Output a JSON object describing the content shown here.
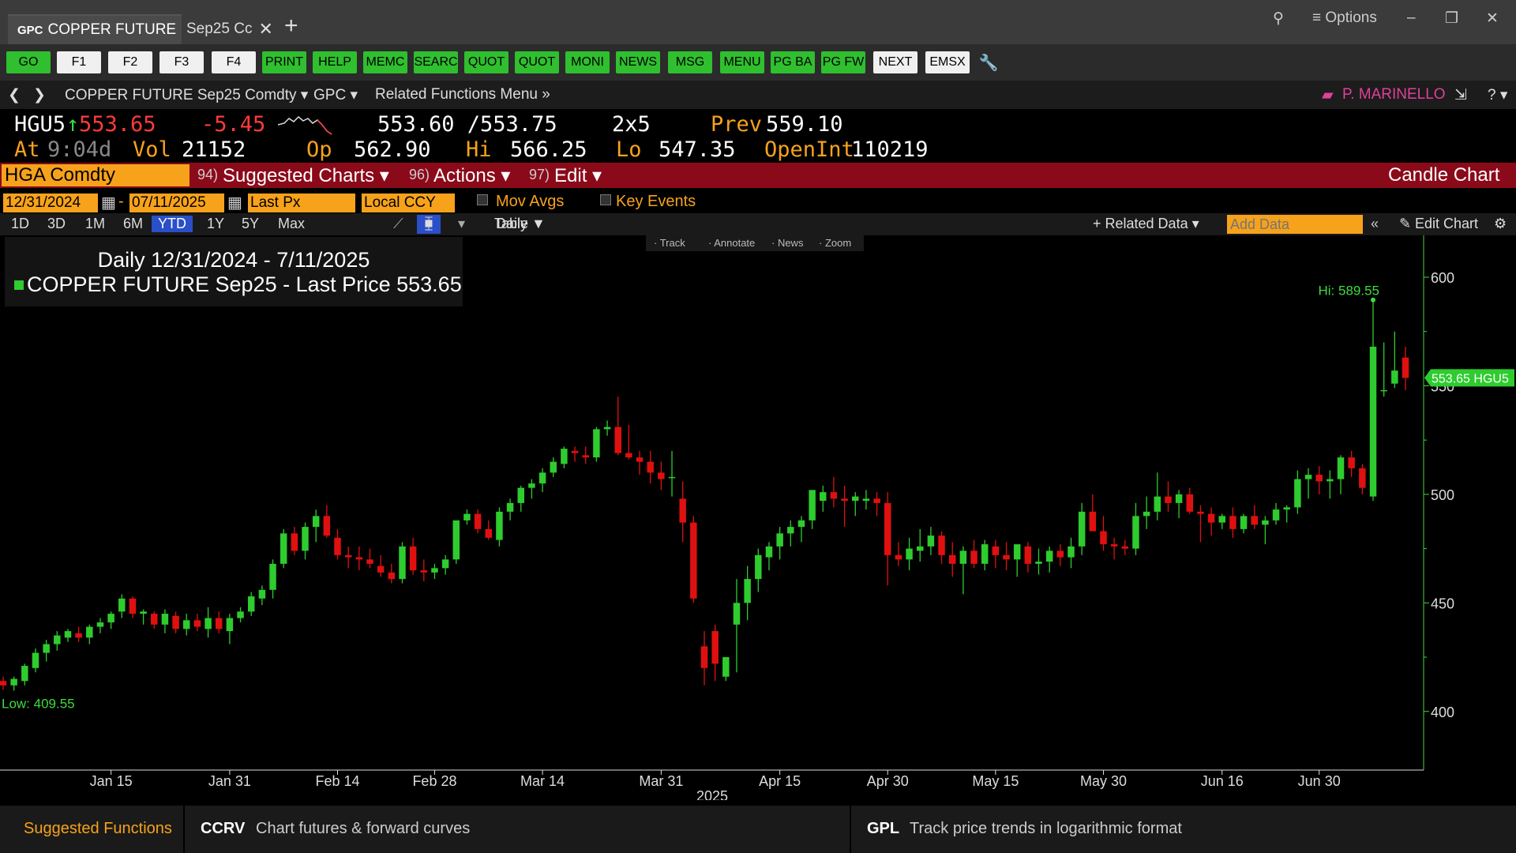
{
  "titlebar": {
    "tab1_prefix": "GPC",
    "tab1_label": "COPPER FUTURE",
    "tab2_label": "Sep25 Cc",
    "close_glyph": "✕",
    "new_tab_glyph": "+",
    "options_label": "≡ Options"
  },
  "buttons": [
    {
      "label": "GO",
      "style": "green"
    },
    {
      "label": "F1",
      "style": "white"
    },
    {
      "label": "F2",
      "style": "white"
    },
    {
      "label": "F3",
      "style": "white"
    },
    {
      "label": "F4",
      "style": "white"
    },
    {
      "label": "PRINT",
      "style": "green"
    },
    {
      "label": "HELP",
      "style": "green"
    },
    {
      "label": "MEMC",
      "style": "green"
    },
    {
      "label": "SEARC",
      "style": "green"
    },
    {
      "label": "QUOT",
      "style": "green"
    },
    {
      "label": "QUOT",
      "style": "green"
    },
    {
      "label": "MONI",
      "style": "green"
    },
    {
      "label": "NEWS",
      "style": "green"
    },
    {
      "label": "MSG",
      "style": "green"
    },
    {
      "label": "MENU",
      "style": "green"
    },
    {
      "label": "PG BA",
      "style": "green"
    },
    {
      "label": "PG FW",
      "style": "green"
    },
    {
      "label": "NEXT",
      "style": "white"
    },
    {
      "label": "EMSX",
      "style": "white"
    }
  ],
  "nav": {
    "security": "COPPER FUTURE Sep25 Comdty ▾",
    "function": "GPC ▾",
    "related": "Related Functions Menu »",
    "user": "P. MARINELLO",
    "help": "? ▾"
  },
  "quote": {
    "ticker": "HGU5",
    "arrow": "↑",
    "last": "553.65",
    "change": "-5.45",
    "bid_ask": "553.60 /553.75",
    "size": "2x5",
    "prev_label": "Prev",
    "prev": "559.10",
    "at_label": "At",
    "at": "9:04d",
    "vol_label": "Vol",
    "vol": "21152",
    "op_label": "Op",
    "op": "562.90",
    "hi_label": "Hi",
    "hi": "566.25",
    "lo_label": "Lo",
    "lo": "547.35",
    "oi_label": "OpenInt",
    "oi": "110219"
  },
  "redbar": {
    "ticker": "HGA Comdty",
    "menu1_num": "94)",
    "menu1": "Suggested Charts ▾",
    "menu2_num": "96)",
    "menu2": "Actions ▾",
    "menu3_num": "97)",
    "menu3": "Edit ▾",
    "chart_type": "Candle Chart"
  },
  "settings": {
    "start": "12/31/2024",
    "end": "07/11/2025",
    "field": "Last Px",
    "ccy": "Local CCY",
    "mov_avgs": "Mov Avgs",
    "key_events": "Key Events"
  },
  "range": {
    "periods": [
      "1D",
      "3D",
      "1M",
      "6M",
      "YTD",
      "1Y",
      "5Y",
      "Max"
    ],
    "active": "YTD",
    "freq": "Daily ▼",
    "table": "Table",
    "related_data": "+ Related Data ▾",
    "add_data_placeholder": "Add Data",
    "edit_chart": "Edit Chart"
  },
  "chart_tools": [
    "Track",
    "Annotate",
    "News",
    "Zoom"
  ],
  "chart_data": {
    "type": "candlestick",
    "title": "Daily 12/31/2024 - 7/11/2025",
    "legend": "COPPER FUTURE Sep25 - Last Price 553.65",
    "last_label": "553.65 HGU5",
    "hi_label": "Hi: 589.55",
    "lo_label": "Low: 409.55",
    "year_label": "2025",
    "ylim": [
      385,
      612
    ],
    "yticks": [
      400,
      450,
      500,
      550,
      600
    ],
    "xticks": [
      {
        "label": "Jan 15",
        "i": 10
      },
      {
        "label": "Jan 31",
        "i": 21
      },
      {
        "label": "Feb 14",
        "i": 31
      },
      {
        "label": "Feb 28",
        "i": 40
      },
      {
        "label": "Mar 14",
        "i": 50
      },
      {
        "label": "Mar 31",
        "i": 61
      },
      {
        "label": "Apr 15",
        "i": 72
      },
      {
        "label": "Apr 30",
        "i": 82
      },
      {
        "label": "May 15",
        "i": 92
      },
      {
        "label": "May 30",
        "i": 102
      },
      {
        "label": "Jun 16",
        "i": 113
      },
      {
        "label": "Jun 30",
        "i": 122
      }
    ],
    "up_color": "#2ecc2e",
    "down_color": "#e01010",
    "ohlc": [
      [
        414,
        416,
        410,
        412
      ],
      [
        412,
        416,
        409.55,
        415
      ],
      [
        414,
        422,
        412,
        421
      ],
      [
        420,
        429,
        418,
        427
      ],
      [
        427,
        433,
        423,
        431
      ],
      [
        431,
        437,
        428,
        435
      ],
      [
        434,
        438,
        432,
        437
      ],
      [
        436,
        439,
        432,
        434
      ],
      [
        434,
        440,
        431,
        439
      ],
      [
        439,
        443,
        436,
        441
      ],
      [
        441,
        446,
        438,
        445
      ],
      [
        446,
        454,
        443,
        452
      ],
      [
        452,
        453,
        443,
        445
      ],
      [
        445,
        447,
        440,
        446
      ],
      [
        445,
        446,
        438,
        440
      ],
      [
        440,
        447,
        436,
        445
      ],
      [
        444,
        446,
        436,
        438
      ],
      [
        438,
        445,
        435,
        442
      ],
      [
        442,
        445,
        437,
        439
      ],
      [
        438,
        448,
        434,
        443
      ],
      [
        443,
        446,
        436,
        438
      ],
      [
        437,
        445,
        431,
        443
      ],
      [
        443,
        448,
        441,
        446
      ],
      [
        446,
        455,
        444,
        453
      ],
      [
        452,
        458,
        449,
        456
      ],
      [
        456,
        470,
        452,
        468
      ],
      [
        468,
        484,
        466,
        482
      ],
      [
        482,
        485,
        472,
        474
      ],
      [
        474,
        487,
        470,
        485
      ],
      [
        485,
        493,
        478,
        490
      ],
      [
        490,
        495,
        480,
        481
      ],
      [
        480,
        484,
        470,
        472
      ],
      [
        472,
        476,
        466,
        471
      ],
      [
        471,
        476,
        465,
        470
      ],
      [
        470,
        475,
        466,
        468
      ],
      [
        467,
        472,
        462,
        464
      ],
      [
        464,
        468,
        459,
        461
      ],
      [
        461,
        478,
        459,
        476
      ],
      [
        476,
        480,
        463,
        465
      ],
      [
        465,
        470,
        460,
        464
      ],
      [
        464,
        468,
        461,
        466
      ],
      [
        466,
        472,
        463,
        470
      ],
      [
        470,
        486,
        468,
        488
      ],
      [
        488,
        493,
        486,
        491
      ],
      [
        491,
        493,
        482,
        484
      ],
      [
        484,
        488,
        479,
        480
      ],
      [
        479,
        494,
        476,
        492
      ],
      [
        492,
        498,
        488,
        496
      ],
      [
        496,
        504,
        492,
        503
      ],
      [
        503,
        507,
        498,
        505
      ],
      [
        505,
        512,
        501,
        510
      ],
      [
        510,
        517,
        508,
        515
      ],
      [
        514,
        522,
        512,
        521
      ],
      [
        520,
        522,
        515,
        519
      ],
      [
        518,
        522,
        514,
        517
      ],
      [
        517,
        531,
        515,
        530
      ],
      [
        530,
        534,
        527,
        531
      ],
      [
        531,
        545,
        518,
        519
      ],
      [
        519,
        532,
        516,
        517
      ],
      [
        517,
        520,
        509,
        515
      ],
      [
        515,
        520,
        505,
        510
      ],
      [
        510,
        515,
        502,
        507
      ],
      [
        508,
        520,
        499,
        508
      ],
      [
        498,
        506,
        478,
        487
      ],
      [
        487,
        490,
        450,
        452
      ],
      [
        430,
        437,
        412,
        420
      ],
      [
        437,
        440,
        414,
        422
      ],
      [
        416,
        425,
        414,
        425
      ],
      [
        440,
        461,
        418,
        450
      ],
      [
        450,
        467,
        442,
        461
      ],
      [
        461,
        475,
        455,
        472
      ],
      [
        471,
        478,
        465,
        476
      ],
      [
        476,
        485,
        470,
        482
      ],
      [
        482,
        488,
        476,
        485
      ],
      [
        485,
        490,
        478,
        488
      ],
      [
        488,
        502,
        484,
        502
      ],
      [
        497,
        504,
        492,
        501
      ],
      [
        501,
        508,
        494,
        498
      ],
      [
        498,
        504,
        485,
        497
      ],
      [
        497,
        501,
        490,
        499
      ],
      [
        497,
        502,
        493,
        498
      ],
      [
        498,
        501,
        490,
        496
      ],
      [
        496,
        501,
        458,
        472
      ],
      [
        472,
        478,
        467,
        470
      ],
      [
        470,
        480,
        465,
        475
      ],
      [
        474,
        484,
        469,
        476
      ],
      [
        476,
        485,
        472,
        481
      ],
      [
        481,
        483,
        468,
        472
      ],
      [
        472,
        478,
        462,
        468
      ],
      [
        468,
        476,
        454,
        474
      ],
      [
        474,
        479,
        466,
        468
      ],
      [
        468,
        479,
        465,
        477
      ],
      [
        476,
        479,
        466,
        472
      ],
      [
        472,
        478,
        465,
        470
      ],
      [
        470,
        476,
        462,
        477
      ],
      [
        476,
        478,
        464,
        468
      ],
      [
        468,
        475,
        463,
        469
      ],
      [
        469,
        476,
        464,
        474
      ],
      [
        474,
        477,
        467,
        471
      ],
      [
        471,
        480,
        466,
        476
      ],
      [
        476,
        496,
        472,
        492
      ],
      [
        492,
        500,
        484,
        483
      ],
      [
        483,
        490,
        474,
        477
      ],
      [
        477,
        480,
        470,
        476
      ],
      [
        476,
        479,
        472,
        475
      ],
      [
        475,
        496,
        472,
        490
      ],
      [
        490,
        499,
        484,
        492
      ],
      [
        492,
        510,
        488,
        499
      ],
      [
        499,
        506,
        492,
        496
      ],
      [
        496,
        502,
        489,
        500
      ],
      [
        500,
        503,
        491,
        492
      ],
      [
        492,
        495,
        478,
        491
      ],
      [
        491,
        494,
        481,
        487
      ],
      [
        487,
        491,
        484,
        490
      ],
      [
        490,
        494,
        480,
        484
      ],
      [
        484,
        491,
        482,
        490
      ],
      [
        490,
        495,
        484,
        486
      ],
      [
        486,
        490,
        477,
        488
      ],
      [
        488,
        496,
        486,
        493
      ],
      [
        493,
        495,
        487,
        494
      ],
      [
        494,
        511,
        491,
        507
      ],
      [
        507,
        512,
        498,
        509
      ],
      [
        509,
        513,
        500,
        506
      ],
      [
        506,
        511,
        498,
        507
      ],
      [
        507,
        518,
        500,
        517
      ],
      [
        517,
        520,
        508,
        512
      ],
      [
        512,
        514,
        500,
        503
      ],
      [
        499,
        589.55,
        497,
        568
      ],
      [
        548,
        570,
        545,
        548
      ],
      [
        551,
        575,
        549,
        557
      ],
      [
        563,
        568,
        548,
        553.65
      ]
    ]
  },
  "footer": {
    "label": "Suggested Functions",
    "f1_code": "CCRV",
    "f1_desc": "Chart futures & forward curves",
    "f2_code": "GPL",
    "f2_desc": "Track price trends in logarithmic format"
  }
}
